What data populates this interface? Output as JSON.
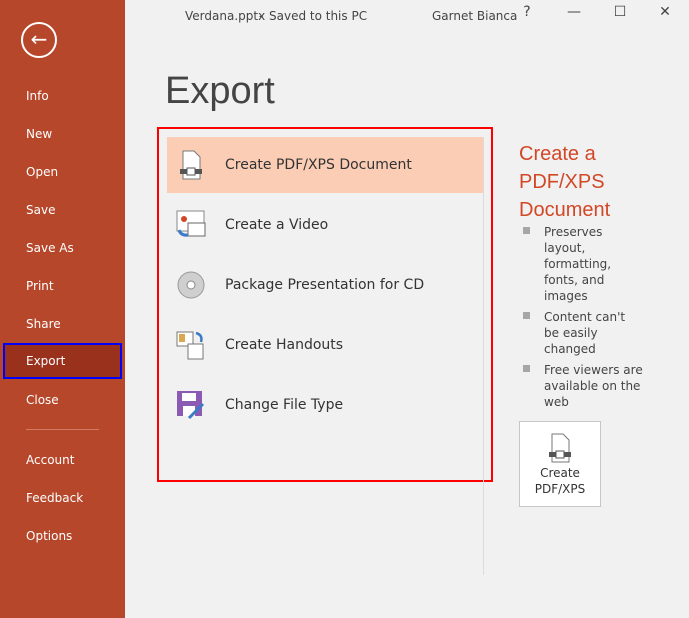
{
  "titlebar": {
    "filename": "Verdana.pptx",
    "sep": "-",
    "status": "Saved to this PC",
    "user": "Garnet Bianca",
    "help": "?",
    "minimize": "—",
    "maximize": "☐",
    "close": "✕"
  },
  "sidebar": {
    "back": "←",
    "items": [
      {
        "label": "Info"
      },
      {
        "label": "New"
      },
      {
        "label": "Open"
      },
      {
        "label": "Save"
      },
      {
        "label": "Save As"
      },
      {
        "label": "Print"
      },
      {
        "label": "Share"
      },
      {
        "label": "Export"
      },
      {
        "label": "Close"
      }
    ],
    "bottom_items": [
      {
        "label": "Account"
      },
      {
        "label": "Feedback"
      },
      {
        "label": "Options"
      }
    ]
  },
  "main": {
    "title": "Export",
    "options": [
      {
        "label": "Create PDF/XPS Document"
      },
      {
        "label": "Create a Video"
      },
      {
        "label": "Package Presentation for CD"
      },
      {
        "label": "Create Handouts"
      },
      {
        "label": "Change File Type"
      }
    ]
  },
  "detail": {
    "title": "Create a PDF/XPS Document",
    "bullets": [
      "Preserves layout, formatting, fonts, and images",
      "Content can't be easily changed",
      "Free viewers are available on the web"
    ],
    "button_line1": "Create",
    "button_line2": "PDF/XPS"
  },
  "colors": {
    "sidebar": "#b7472a",
    "selected_option": "#fbcdb5",
    "accent": "#d24726"
  }
}
